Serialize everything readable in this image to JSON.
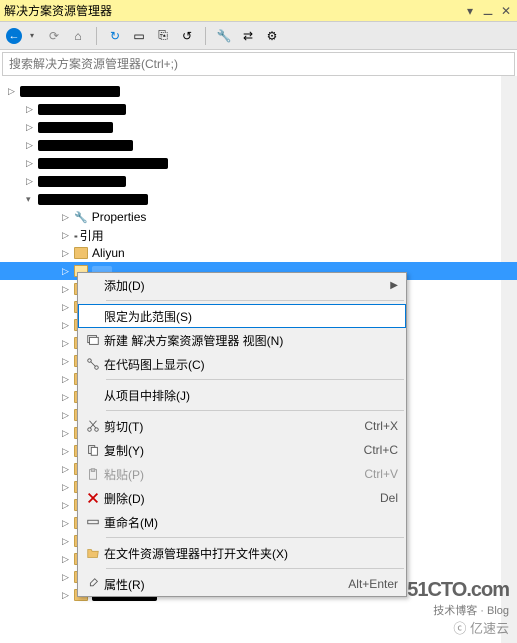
{
  "window": {
    "title": "解决方案资源管理器",
    "pin_glyph": "⚊",
    "close_glyph": "✕"
  },
  "toolbar": {
    "back_glyph": "←",
    "forward_glyph": "⟳",
    "home_glyph": "⌂",
    "sync_glyph": "↻",
    "collapse_glyph": "▭",
    "copy_glyph": "⎘",
    "refresh_glyph": "↺",
    "properties_glyph": "🔧",
    "showall_glyph": "⇄",
    "view_glyph": "⚙"
  },
  "search": {
    "placeholder": "搜索解决方案资源管理器(Ctrl+;)"
  },
  "tree": {
    "properties_label": "Properties",
    "references_label": "引用",
    "aliyun_label": "Aliyun"
  },
  "context_menu": {
    "items": [
      {
        "icon": "",
        "label": "添加(D)",
        "shortcut": "",
        "arrow": "▶",
        "kind": "item"
      },
      {
        "kind": "sep"
      },
      {
        "icon": "",
        "label": "限定为此范围(S)",
        "shortcut": "",
        "kind": "item",
        "selected": true
      },
      {
        "icon": "new-view",
        "label": "新建 解决方案资源管理器 视图(N)",
        "shortcut": "",
        "kind": "item"
      },
      {
        "icon": "codemap",
        "label": "在代码图上显示(C)",
        "shortcut": "",
        "kind": "item"
      },
      {
        "kind": "sep"
      },
      {
        "icon": "",
        "label": "从项目中排除(J)",
        "shortcut": "",
        "kind": "item"
      },
      {
        "kind": "sep"
      },
      {
        "icon": "cut",
        "label": "剪切(T)",
        "shortcut": "Ctrl+X",
        "kind": "item"
      },
      {
        "icon": "copy",
        "label": "复制(Y)",
        "shortcut": "Ctrl+C",
        "kind": "item"
      },
      {
        "icon": "paste",
        "label": "粘贴(P)",
        "shortcut": "Ctrl+V",
        "kind": "item",
        "disabled": true
      },
      {
        "icon": "delete",
        "label": "删除(D)",
        "shortcut": "Del",
        "kind": "item"
      },
      {
        "icon": "rename",
        "label": "重命名(M)",
        "shortcut": "",
        "kind": "item"
      },
      {
        "kind": "sep"
      },
      {
        "icon": "open-folder",
        "label": "在文件资源管理器中打开文件夹(X)",
        "shortcut": "",
        "kind": "item"
      },
      {
        "kind": "sep"
      },
      {
        "icon": "properties",
        "label": "属性(R)",
        "shortcut": "Alt+Enter",
        "kind": "item"
      }
    ]
  },
  "watermark": {
    "line1": "51CTO.com",
    "line2": "技术博客 · Blog",
    "line3": "ⓒ 亿速云"
  }
}
